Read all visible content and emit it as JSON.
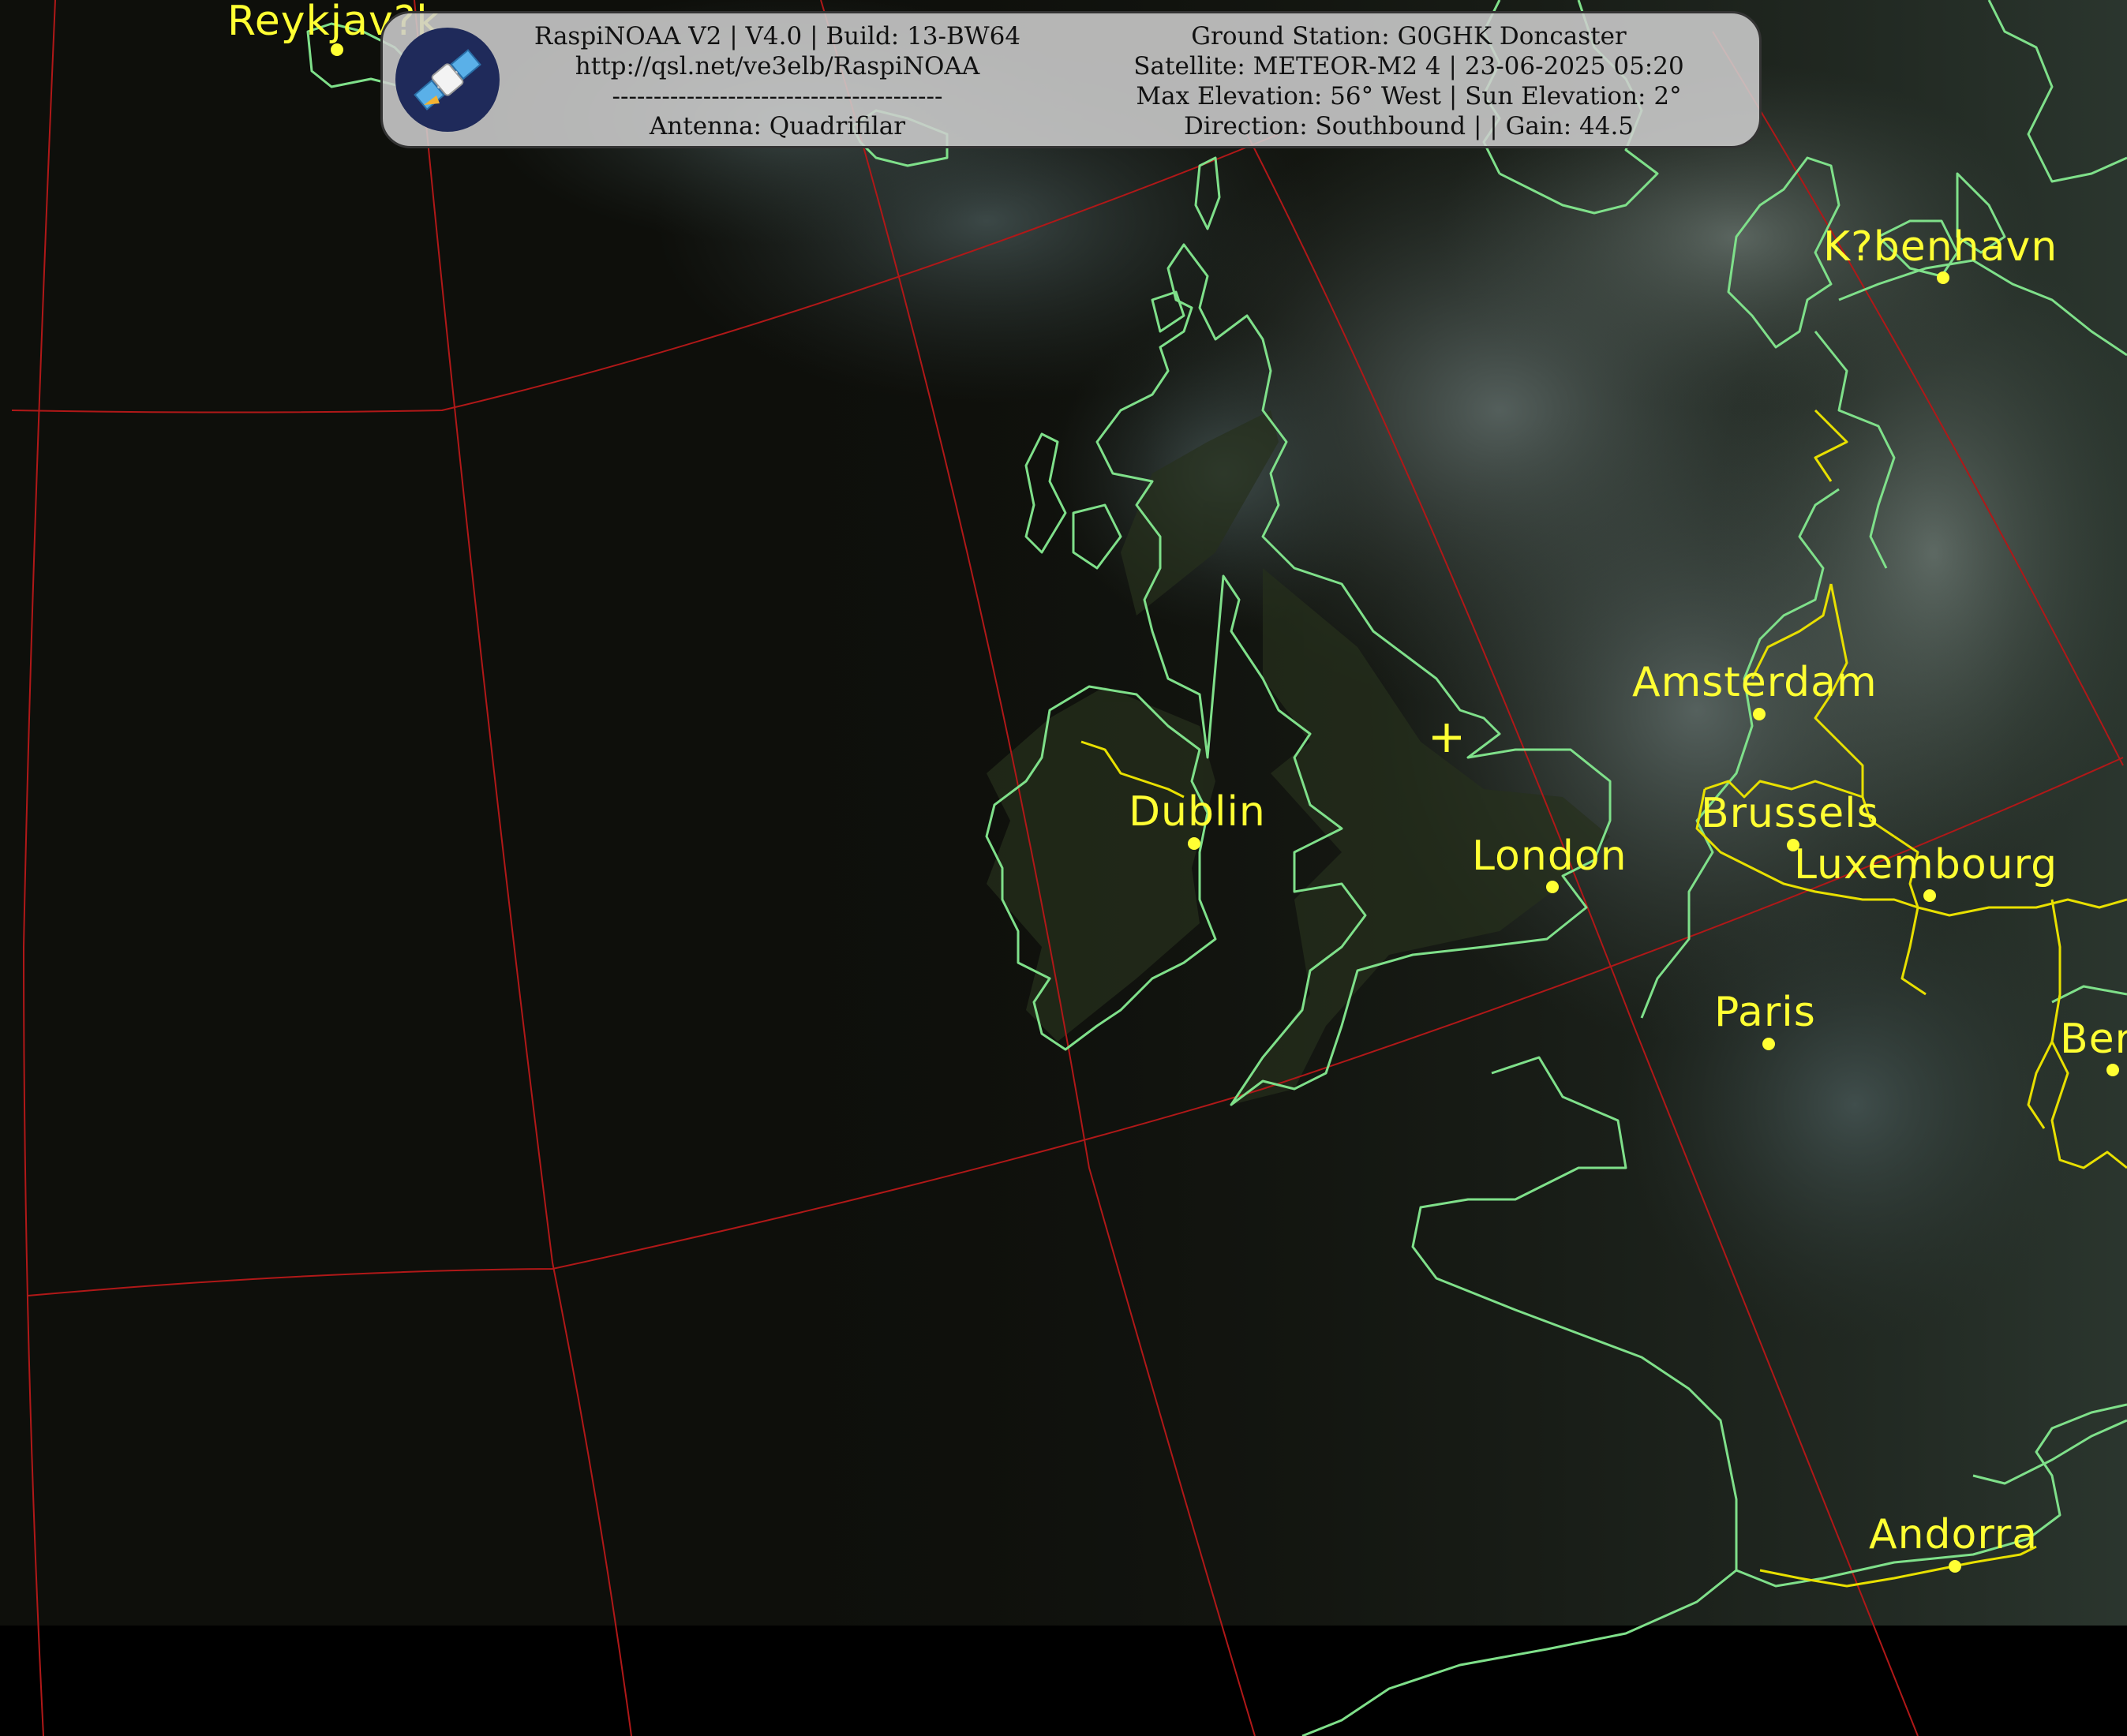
{
  "header": {
    "left_lines": [
      "RaspiNOAA V2 | V4.0 | Build: 13-BW64",
      "http://qsl.net/ve3elb/RaspiNOAA",
      "----------------------------------------",
      "Antenna: Quadrifilar"
    ],
    "right_lines": [
      "Ground Station: G0GHK Doncaster",
      "Satellite: METEOR-M2 4 | 23-06-2025 05:20",
      "Max Elevation: 56° West | Sun Elevation: 2°",
      "Direction: Southbound | | Gain: 44.5"
    ],
    "logo_icon": "satellite-icon"
  },
  "cities": [
    {
      "name": "Reykjav?k"
    },
    {
      "name": "K?benhavn"
    },
    {
      "name": "Amsterdam"
    },
    {
      "name": "Dublin"
    },
    {
      "name": "London"
    },
    {
      "name": "Brussels"
    },
    {
      "name": "Luxembourg"
    },
    {
      "name": "Paris"
    },
    {
      "name": "Ber"
    },
    {
      "name": "Andorra"
    }
  ],
  "ground_station_marker": "crosshair-icon",
  "colors": {
    "coastline": "#7fe08a",
    "borders": "#e8e000",
    "labels": "#ffff33",
    "graticule": "#b01818",
    "ocean": "#0e0f0b"
  }
}
